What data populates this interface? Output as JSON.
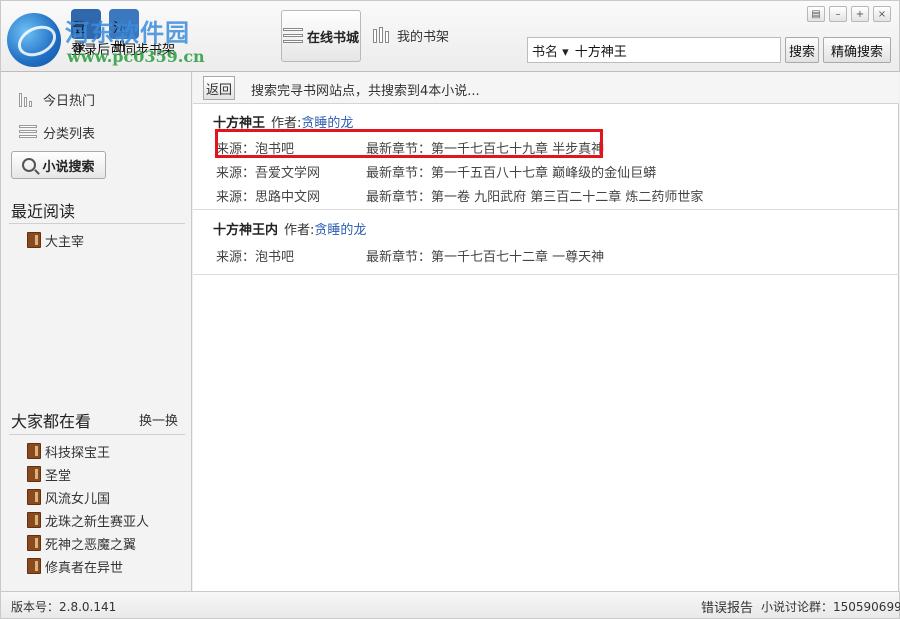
{
  "header": {
    "watermark_title": "河东软件园",
    "watermark_url": "www.pc0359.cn",
    "login_label": "登录",
    "register_label": "注册",
    "login_hint": "登录后可同步书架",
    "tab_online": "在线书城",
    "tab_shelf": "我的书架",
    "search_type": "书名",
    "search_value": "十方神王",
    "search_button": "搜索",
    "precise_search_button": "精确搜索"
  },
  "sidebar": {
    "nav": [
      {
        "label": "今日热门"
      },
      {
        "label": "分类列表"
      },
      {
        "label": "小说搜索"
      }
    ],
    "recent_title": "最近阅读",
    "recent_books": [
      "大主宰"
    ],
    "popular_title": "大家都在看",
    "refresh_label": "换一换",
    "popular_books": [
      "科技探宝王",
      "圣堂",
      "风流女儿国",
      "龙珠之新生赛亚人",
      "死神之恶魔之翼",
      "修真者在异世"
    ]
  },
  "main": {
    "back_button": "返回",
    "status": "搜索完寻书网站点，共搜索到4本小说...",
    "author_label": "作者:",
    "results": [
      {
        "title": "十方神王",
        "author": "贪睡的龙",
        "sources": [
          {
            "source": "来源：泡书吧",
            "chapter": "最新章节：第一千七百七十九章 半步真神"
          },
          {
            "source": "来源：吾爱文学网",
            "chapter": "最新章节：第一千五百八十七章 巅峰级的金仙巨蟒"
          },
          {
            "source": "来源：思路中文网",
            "chapter": "最新章节：第一卷 九阳武府 第三百二十二章 炼二药师世家"
          }
        ]
      },
      {
        "title": "十方神王内",
        "author": "贪睡的龙",
        "sources": [
          {
            "source": "来源：泡书吧",
            "chapter": "最新章节：第一千七百七十二章 一尊天神"
          }
        ]
      }
    ]
  },
  "footer": {
    "version": "版本号：2.8.0.141",
    "error_report": "错误报告",
    "forum_group": "小说讨论群：150590699"
  },
  "colors": {
    "highlight_border": "#e3141c",
    "author_link": "#2a5db0"
  }
}
